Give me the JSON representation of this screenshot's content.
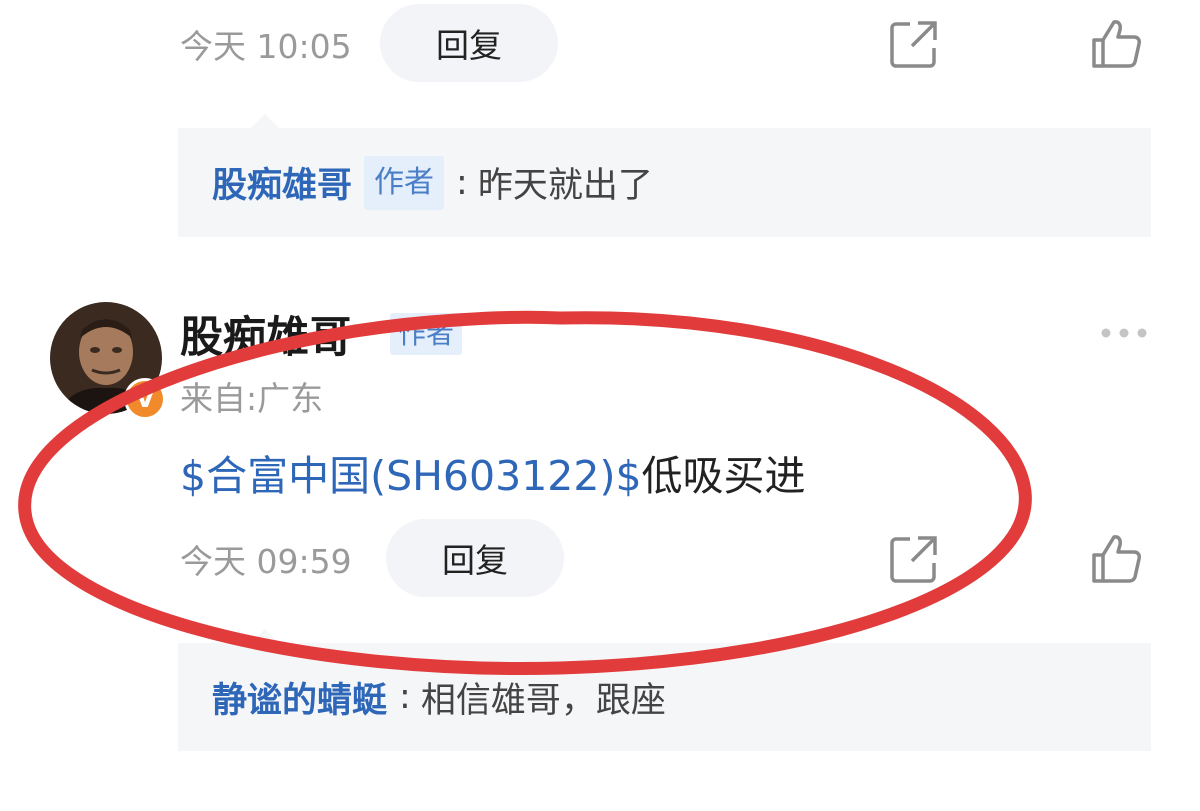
{
  "top_comment": {
    "timestamp": "今天 10:05",
    "reply_label": "回复",
    "reply": {
      "author": "股痴雄哥",
      "author_tag": "作者",
      "separator": ":",
      "text": "昨天就出了"
    }
  },
  "comment": {
    "author": "股痴雄哥",
    "author_tag": "作者",
    "verified_badge": "V",
    "location": "来自:广东",
    "stock_link": "$合富中国(SH603122)$",
    "text": "低吸买进",
    "timestamp": "今天 09:59",
    "reply_label": "回复",
    "reply": {
      "author": "静谧的蜻蜓",
      "separator": ":",
      "text": "相信雄哥，跟座"
    }
  },
  "icons": {
    "share": "share-icon",
    "like": "thumbs-up-icon",
    "more": "more-dots-icon"
  },
  "colors": {
    "link_blue": "#2f67b8",
    "annotation_red": "#e23b3b",
    "badge_orange": "#f08a2b"
  }
}
